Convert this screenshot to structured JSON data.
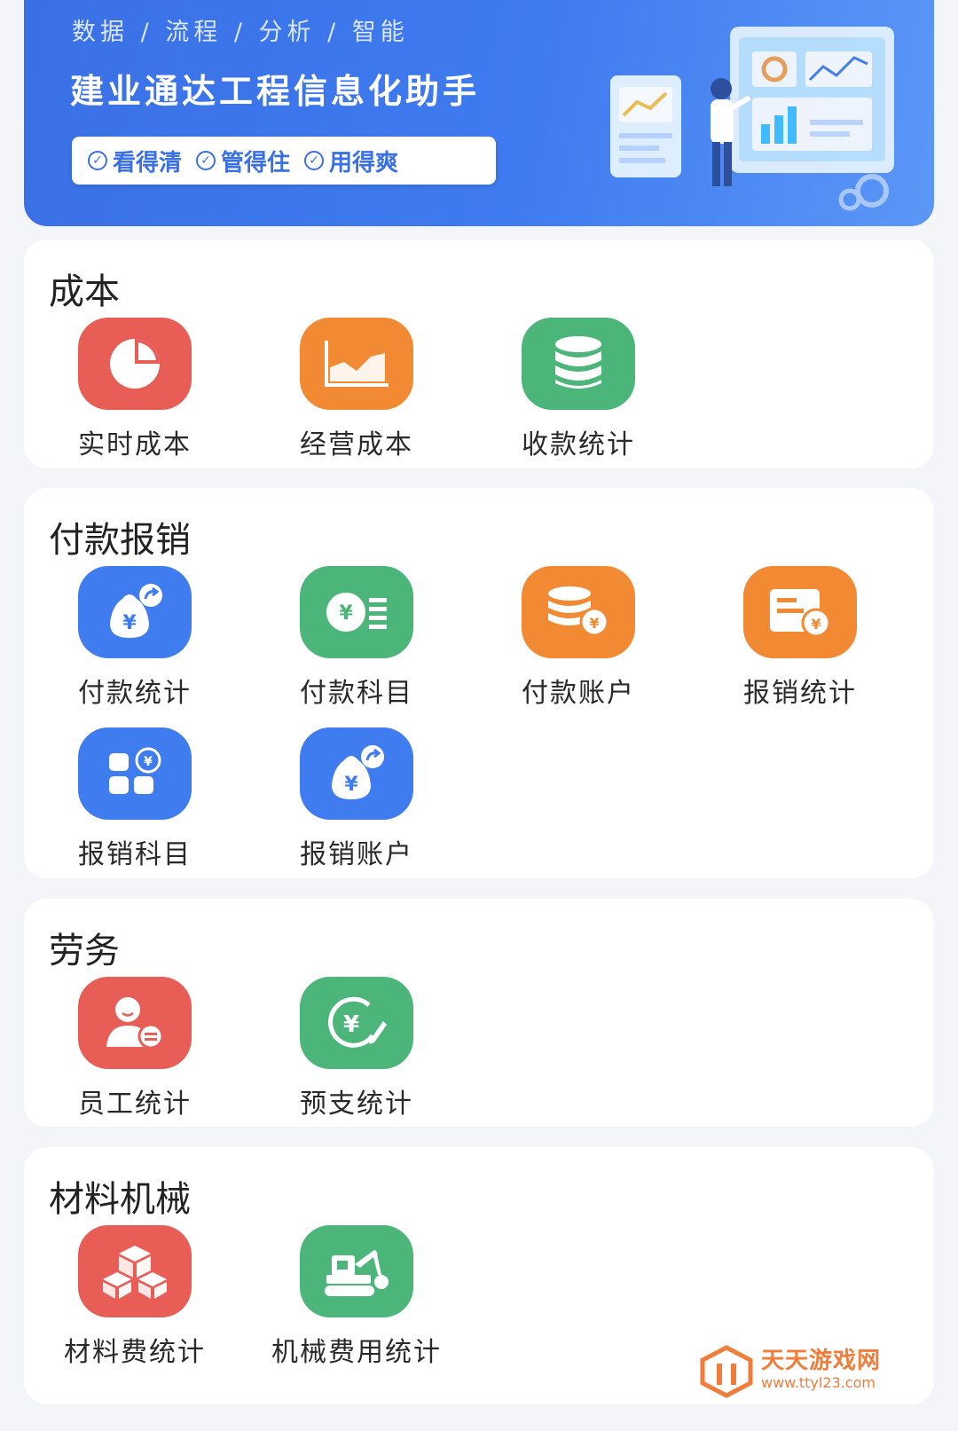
{
  "banner": {
    "tagline": "数据 / 流程 / 分析 / 智能",
    "title": "建业通达工程信息化助手",
    "pill": [
      "看得清",
      "管得住",
      "用得爽"
    ]
  },
  "sections": [
    {
      "title": "成本",
      "items": [
        {
          "label": "实时成本",
          "color": "#e85d55",
          "icon": "pie-chart-icon"
        },
        {
          "label": "经营成本",
          "color": "#f18a33",
          "icon": "area-chart-icon"
        },
        {
          "label": "收款统计",
          "color": "#4cb67a",
          "icon": "database-icon"
        }
      ]
    },
    {
      "title": "付款报销",
      "items": [
        {
          "label": "付款统计",
          "color": "#3f7cf0",
          "icon": "money-bag-icon"
        },
        {
          "label": "付款科目",
          "color": "#4cb67a",
          "icon": "yuan-coin-list-icon"
        },
        {
          "label": "付款账户",
          "color": "#f18a33",
          "icon": "coin-stack-icon"
        },
        {
          "label": "报销统计",
          "color": "#f18a33",
          "icon": "invoice-yuan-icon"
        },
        {
          "label": "报销科目",
          "color": "#3f7cf0",
          "icon": "grid-yuan-icon"
        },
        {
          "label": "报销账户",
          "color": "#3f7cf0",
          "icon": "money-bag-icon"
        }
      ]
    },
    {
      "title": "劳务",
      "items": [
        {
          "label": "员工统计",
          "color": "#e85d55",
          "icon": "user-icon"
        },
        {
          "label": "预支统计",
          "color": "#4cb67a",
          "icon": "yuan-edit-icon"
        }
      ]
    },
    {
      "title": "材料机械",
      "items": [
        {
          "label": "材料费统计",
          "color": "#e85d55",
          "icon": "boxes-icon"
        },
        {
          "label": "机械费用统计",
          "color": "#4cb67a",
          "icon": "excavator-icon"
        }
      ]
    }
  ],
  "watermark": {
    "text": "天天游戏网",
    "url": "www.ttyl23.com"
  }
}
